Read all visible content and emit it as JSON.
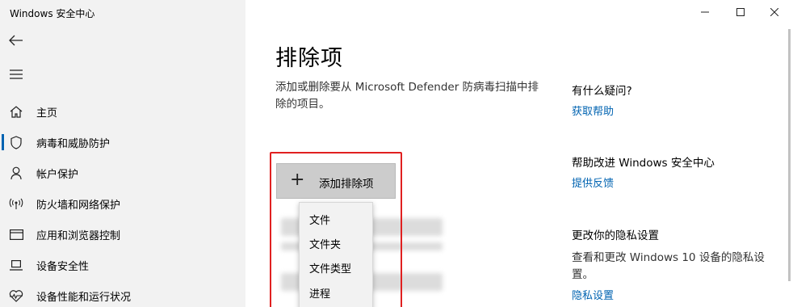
{
  "window": {
    "title": "Windows 安全中心"
  },
  "sidebar": {
    "items": [
      {
        "label": "主页",
        "icon": "home-icon"
      },
      {
        "label": "病毒和威胁防护",
        "icon": "shield-icon"
      },
      {
        "label": "帐户保护",
        "icon": "person-icon"
      },
      {
        "label": "防火墙和网络保护",
        "icon": "wifi-antenna-icon"
      },
      {
        "label": "应用和浏览器控制",
        "icon": "browser-window-icon"
      },
      {
        "label": "设备安全性",
        "icon": "laptop-icon"
      },
      {
        "label": "设备性能和运行状况",
        "icon": "heart-pulse-icon"
      }
    ]
  },
  "main": {
    "title": "排除项",
    "description": "添加或删除要从 Microsoft Defender 防病毒扫描中排除的项目。",
    "add_button": "添加排除项",
    "dropdown": [
      "文件",
      "文件夹",
      "文件类型",
      "进程"
    ]
  },
  "right_panel": {
    "questions_heading": "有什么疑问?",
    "help_link": "获取帮助",
    "improve_heading": "帮助改进 Windows 安全中心",
    "feedback_link": "提供反馈",
    "privacy_heading": "更改你的隐私设置",
    "privacy_text": "查看和更改 Windows 10 设备的隐私设置。",
    "privacy_link": "隐私设置"
  },
  "colors": {
    "accent": "#0063b1",
    "highlight": "#e02020",
    "sidebar_bg": "#f2f2f2"
  }
}
